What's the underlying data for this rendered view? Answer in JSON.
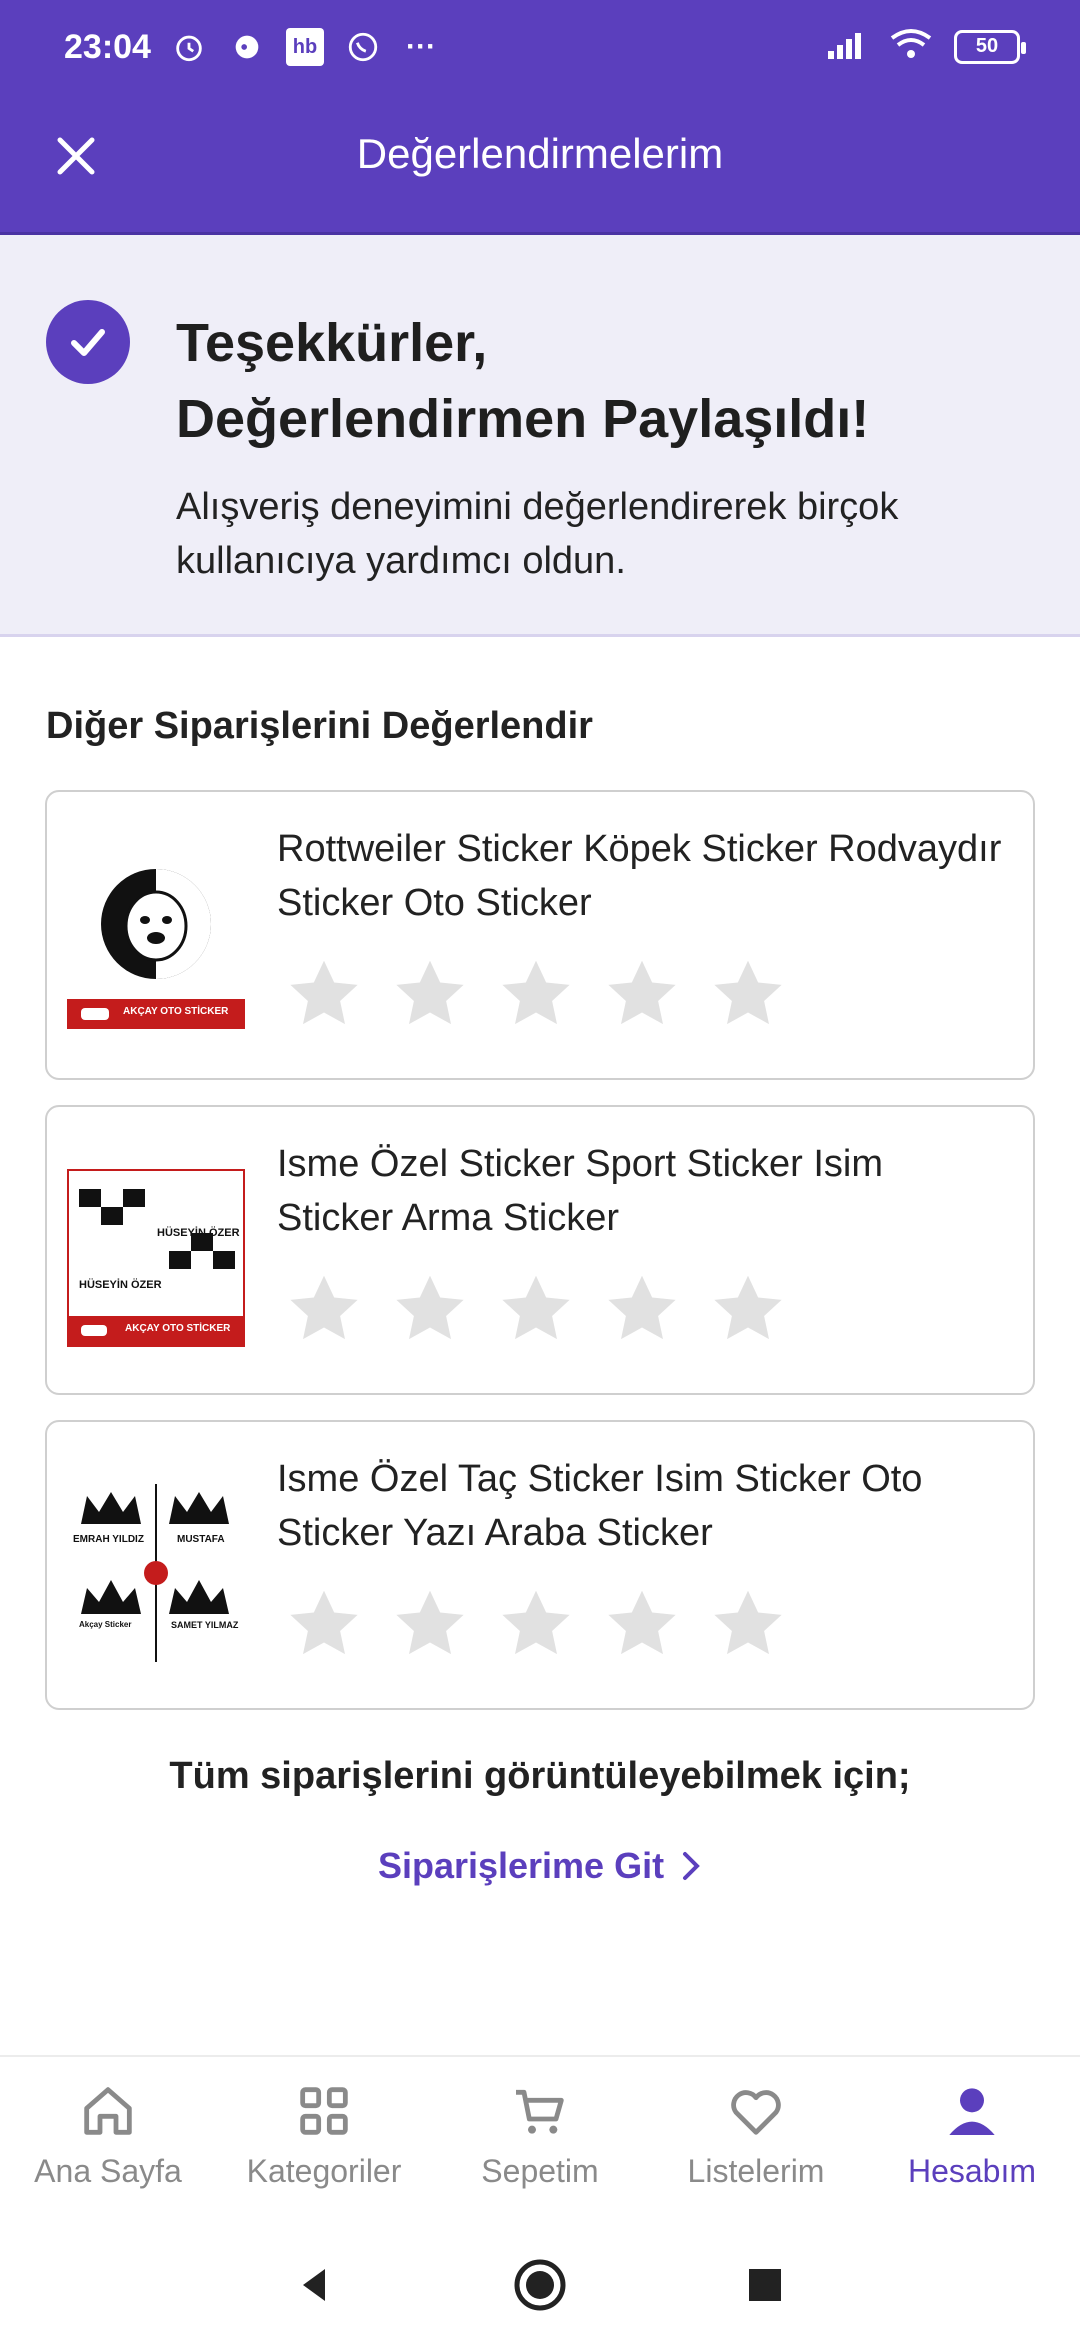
{
  "status_bar": {
    "time": "23:04",
    "icons": [
      "alarm-icon",
      "chat-icon",
      "hb-icon",
      "whatsapp-icon",
      "more-icon"
    ],
    "hb_label": "hb",
    "more_label": "···",
    "battery": "50"
  },
  "header": {
    "title": "Değerlendirmelerim",
    "close_icon": "close-icon"
  },
  "banner": {
    "title_line1": "Teşekkürler,",
    "title_line2": "Değerlendirmen Paylaşıldı!",
    "text": "Alışveriş deneyimini değerlendirerek birçok kullanıcıya yardımcı oldun."
  },
  "section": {
    "title": "Diğer Siparişlerini Değerlendir"
  },
  "products": [
    {
      "name": "Rottweiler Sticker Köpek Sticker Rodvaydır Sticker Oto Sticker",
      "brand": "AKÇAY OTO STİCKER",
      "rating": 0
    },
    {
      "name": "Isme Özel Sticker Sport Sticker Isim Sticker Arma Sticker",
      "brand": "AKÇAY OTO STİCKER",
      "thumb_text_1": "HÜSEYİN ÖZER",
      "thumb_text_2": "HÜSEYİN ÖZER",
      "rating": 0
    },
    {
      "name": "Isme Özel Taç Sticker Isim Sticker Oto Sticker Yazı Araba Sticker",
      "thumb_text_1": "EMRAH YILDIZ",
      "thumb_text_2": "MUSTAFA",
      "thumb_text_3": "SAMET YILMAZ",
      "thumb_text_4": "Akçay Sticker",
      "rating": 0
    }
  ],
  "footer": {
    "all_orders_text": "Tüm siparişlerini görüntüleyebilmek için;",
    "link": "Siparişlerime Git"
  },
  "bottom_nav": [
    {
      "label": "Ana Sayfa",
      "icon": "home-icon"
    },
    {
      "label": "Kategoriler",
      "icon": "grid-icon"
    },
    {
      "label": "Sepetim",
      "icon": "cart-icon"
    },
    {
      "label": "Listelerim",
      "icon": "heart-icon"
    },
    {
      "label": "Hesabım",
      "icon": "user-icon",
      "active": true
    }
  ],
  "colors": {
    "primary": "#5b3fbd",
    "banner_bg": "#efeef8",
    "star_empty": "#e1e1e1"
  }
}
